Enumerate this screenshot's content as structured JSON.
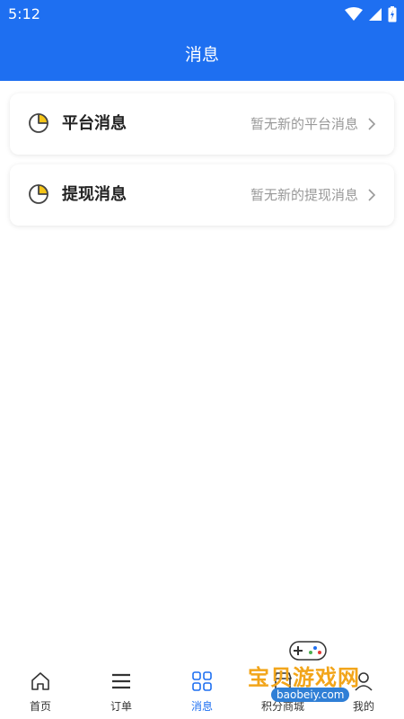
{
  "status_bar": {
    "time": "5:12"
  },
  "header": {
    "title": "消息"
  },
  "messages": [
    {
      "title": "平台消息",
      "desc": "暂无新的平台消息"
    },
    {
      "title": "提现消息",
      "desc": "暂无新的提现消息"
    }
  ],
  "tabs": [
    {
      "label": "首页",
      "icon": "home-icon"
    },
    {
      "label": "订单",
      "icon": "list-icon"
    },
    {
      "label": "消息",
      "icon": "grid-icon",
      "active": true
    },
    {
      "label": "积分商城",
      "icon": "store-icon"
    },
    {
      "label": "我的",
      "icon": "profile-icon"
    }
  ],
  "watermark": {
    "text": "宝贝游戏网",
    "url": "baobeiy.com"
  },
  "colors": {
    "primary": "#1e6ff1",
    "accent_yellow": "#f5c518",
    "muted": "#999999"
  }
}
